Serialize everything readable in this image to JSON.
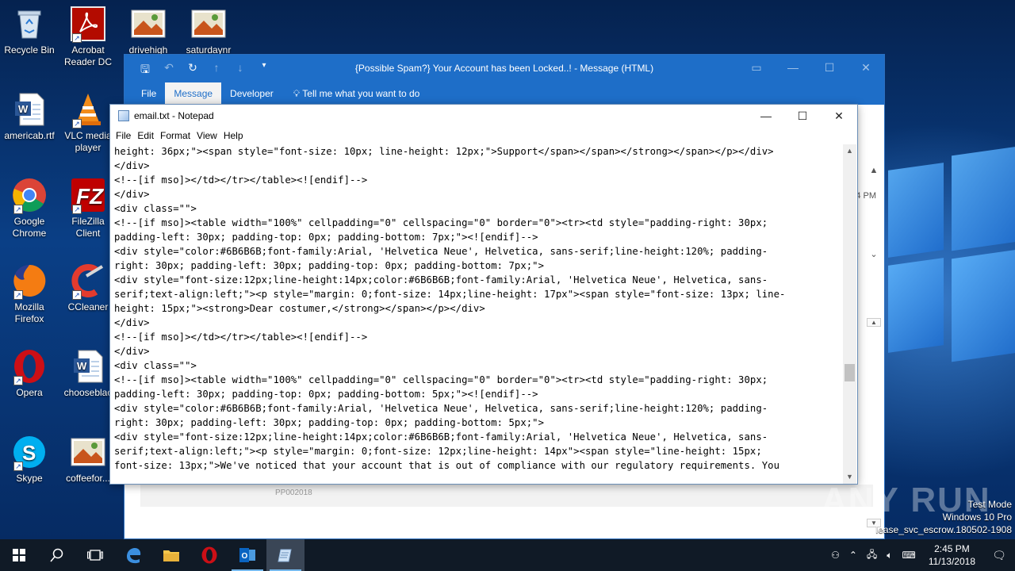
{
  "desktop": {
    "icons": [
      {
        "label": "Recycle Bin",
        "icon": "recycle-bin-icon"
      },
      {
        "label": "Acrobat Reader DC",
        "icon": "acrobat-icon"
      },
      {
        "label": "drivehigh",
        "icon": "image-file-icon"
      },
      {
        "label": "saturdaynr",
        "icon": "image-file-icon"
      },
      {
        "label": "americab.rtf",
        "icon": "word-doc-icon"
      },
      {
        "label": "VLC media player",
        "icon": "vlc-icon"
      },
      {
        "label": "Google Chrome",
        "icon": "chrome-icon"
      },
      {
        "label": "FileZilla Client",
        "icon": "filezilla-icon"
      },
      {
        "label": "Mozilla Firefox",
        "icon": "firefox-icon"
      },
      {
        "label": "CCleaner",
        "icon": "ccleaner-icon"
      },
      {
        "label": "Opera",
        "icon": "opera-icon"
      },
      {
        "label": "chooseblac",
        "icon": "word-doc-icon"
      },
      {
        "label": "Skype",
        "icon": "skype-icon"
      },
      {
        "label": "coffeefor...",
        "icon": "image-file-icon"
      }
    ]
  },
  "outlook": {
    "title": "{Possible Spam?} Your Account has been Locked..! - Message (HTML)",
    "tabs": [
      "File",
      "Message",
      "Developer"
    ],
    "active_tab": "Message",
    "tell_me": "Tell me what you want to do",
    "time_fragment": "4 PM",
    "footer_code": "PP002018"
  },
  "notepad": {
    "title": "email.txt - Notepad",
    "menu": [
      "File",
      "Edit",
      "Format",
      "View",
      "Help"
    ],
    "lines": [
      "height: 36px;\"><span style=\"font-size: 10px; line-height: 12px;\">Support</span></span></strong></span></p></div>",
      "</div>",
      "<!--[if mso]></td></tr></table><![endif]-->",
      "</div>",
      "<div class=\"\">",
      "<!--[if mso]><table width=\"100%\" cellpadding=\"0\" cellspacing=\"0\" border=\"0\"><tr><td style=\"padding-right: 30px;",
      "padding-left: 30px; padding-top: 0px; padding-bottom: 7px;\"><![endif]-->",
      "<div style=\"color:#6B6B6B;font-family:Arial, 'Helvetica Neue', Helvetica, sans-serif;line-height:120%; padding-",
      "right: 30px; padding-left: 30px; padding-top: 0px; padding-bottom: 7px;\">",
      "<div style=\"font-size:12px;line-height:14px;color:#6B6B6B;font-family:Arial, 'Helvetica Neue', Helvetica, sans-",
      "serif;text-align:left;\"><p style=\"margin: 0;font-size: 14px;line-height: 17px\"><span style=\"font-size: 13px; line-",
      "height: 15px;\"><strong>Dear costumer,</strong></span></p></div>",
      "</div>",
      "<!--[if mso]></td></tr></table><![endif]-->",
      "</div>",
      "<div class=\"\">",
      "<!--[if mso]><table width=\"100%\" cellpadding=\"0\" cellspacing=\"0\" border=\"0\"><tr><td style=\"padding-right: 30px;",
      "padding-left: 30px; padding-top: 0px; padding-bottom: 5px;\"><![endif]-->",
      "<div style=\"color:#6B6B6B;font-family:Arial, 'Helvetica Neue', Helvetica, sans-serif;line-height:120%; padding-",
      "right: 30px; padding-left: 30px; padding-top: 0px; padding-bottom: 5px;\">",
      "<div style=\"font-size:12px;line-height:14px;color:#6B6B6B;font-family:Arial, 'Helvetica Neue', Helvetica, sans-",
      "serif;text-align:left;\"><p style=\"margin: 0;font-size: 12px;line-height: 14px\"><span style=\"line-height: 15px;",
      "font-size: 13px;\">We've noticed that your account that is out of compliance with our regulatory requirements. You"
    ]
  },
  "taskbar": {
    "time": "2:45 PM",
    "date": "11/13/2018"
  },
  "watermark": {
    "line1": "Test Mode",
    "line2": "Windows 10 Pro",
    "line3": "lease_svc_escrow.180502-1908",
    "brand": "ANY RUN"
  },
  "colors": {
    "outlook_blue": "#1e6ec8",
    "taskbar": "#101a26"
  }
}
